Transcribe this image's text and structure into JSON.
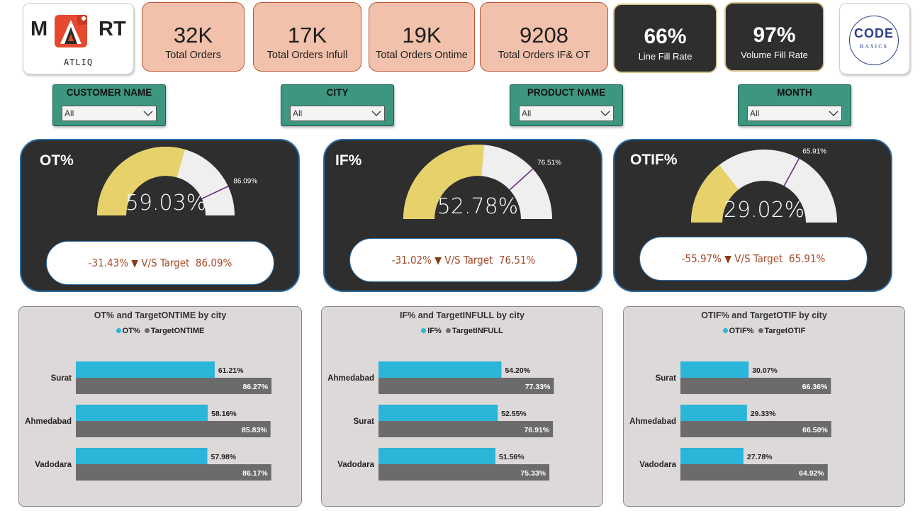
{
  "logos": {
    "mart": {
      "left": "M",
      "right": "RT",
      "subtitle": "ATLIQ"
    },
    "codebasics": {
      "main": "CODE",
      "sub": "BASICS"
    }
  },
  "kpis": [
    {
      "value": "32K",
      "label": "Total Orders"
    },
    {
      "value": "17K",
      "label": "Total Orders Infull"
    },
    {
      "value": "19K",
      "label": "Total Orders Ontime"
    },
    {
      "value": "9208",
      "label": "Total Orders IF& OT"
    },
    {
      "value": "66%",
      "label": "Line Fill Rate"
    },
    {
      "value": "97%",
      "label": "Volume Fill Rate"
    }
  ],
  "slicers": [
    {
      "title": "CUSTOMER NAME",
      "value": "All"
    },
    {
      "title": "CITY",
      "value": "All"
    },
    {
      "title": "PRODUCT NAME",
      "value": "All"
    },
    {
      "title": "MONTH",
      "value": "All"
    }
  ],
  "gauges": [
    {
      "title": "OT%",
      "value_label": "59.03%",
      "value": 59.03,
      "target": 86.09,
      "target_label": "86.09%",
      "diff": "-31.43%",
      "vs_label": "V/S Target",
      "target_text": "86.09%"
    },
    {
      "title": "IF%",
      "value_label": "52.78%",
      "value": 52.78,
      "target": 76.51,
      "target_label": "76.51%",
      "diff": "-31.02%",
      "vs_label": "V/S Target",
      "target_text": "76.51%"
    },
    {
      "title": "OTIF%",
      "value_label": "29.02%",
      "value": 29.02,
      "target": 65.91,
      "target_label": "65.91%",
      "diff": "-55.97%",
      "vs_label": "V/S Target",
      "target_text": "65.91%"
    }
  ],
  "colors": {
    "gauge_fill": "#e6d16a",
    "gauge_track": "#f0efef",
    "bar_actual": "#2bb5d8",
    "bar_target": "#6b6b6b"
  },
  "chart_data": [
    {
      "type": "bar",
      "title": "OT% and TargetONTIME by city",
      "categories": [
        "Surat",
        "Ahmedabad",
        "Vadodara"
      ],
      "series": [
        {
          "name": "OT%",
          "values": [
            61.21,
            58.16,
            57.98
          ],
          "labels": [
            "61.21%",
            "58.16%",
            "57.98%"
          ]
        },
        {
          "name": "TargetONTIME",
          "values": [
            86.27,
            85.83,
            86.17
          ],
          "labels": [
            "86.27%",
            "85.83%",
            "86.17%"
          ]
        }
      ]
    },
    {
      "type": "bar",
      "title": "IF% and TargetINFULL by city",
      "categories": [
        "Ahmedabad",
        "Surat",
        "Vadodara"
      ],
      "series": [
        {
          "name": "IF%",
          "values": [
            54.2,
            52.55,
            51.56
          ],
          "labels": [
            "54.20%",
            "52.55%",
            "51.56%"
          ]
        },
        {
          "name": "TargetINFULL",
          "values": [
            77.33,
            76.91,
            75.33
          ],
          "labels": [
            "77.33%",
            "76.91%",
            "75.33%"
          ]
        }
      ]
    },
    {
      "type": "bar",
      "title": "OTIF% and TargetOTIF by city",
      "categories": [
        "Surat",
        "Ahmedabad",
        "Vadodara"
      ],
      "series": [
        {
          "name": "OTIF%",
          "values": [
            30.07,
            29.33,
            27.78
          ],
          "labels": [
            "30.07%",
            "29.33%",
            "27.78%"
          ]
        },
        {
          "name": "TargetOTIF",
          "values": [
            66.36,
            66.5,
            64.92
          ],
          "labels": [
            "66.36%",
            "66.50%",
            "64.92%"
          ]
        }
      ]
    }
  ]
}
